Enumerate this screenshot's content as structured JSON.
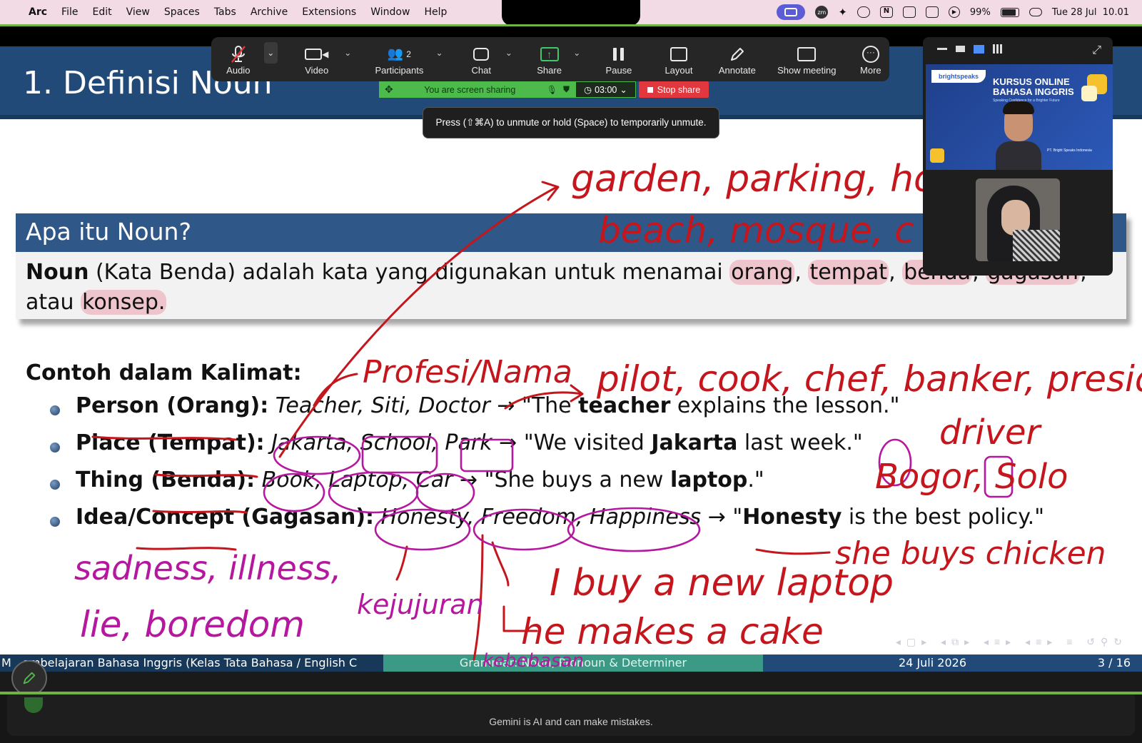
{
  "menubar": {
    "app": "Arc",
    "items": [
      "File",
      "Edit",
      "View",
      "Spaces",
      "Tabs",
      "Archive",
      "Extensions",
      "Window",
      "Help"
    ],
    "battery": "99%",
    "datetime": "Tue 28 Jul  10.01"
  },
  "slide": {
    "title": "1. Definisi Noun",
    "block_title": "Apa itu Noun?",
    "definition": {
      "term": "Noun",
      "rest": " (Kata Benda) adalah kata yang digunakan untuk menamai ",
      "w1": "orang",
      "w2": "tempat",
      "w3": "benda",
      "w4": "gagasan",
      "or": "atau",
      "w5": "konsep."
    },
    "examples_title": "Contoh dalam Kalimat:",
    "rows": [
      {
        "cat": "Person (Orang):",
        "ex": "Teacher, Siti, Doctor",
        "arrow": "→",
        "q1": "\"The ",
        "bold": "teacher",
        "q2": " explains the lesson.\""
      },
      {
        "cat": "Place (Tempat):",
        "ex": "Jakarta, School, Park",
        "arrow": "→",
        "q1": "\"We visited ",
        "bold": "Jakarta",
        "q2": " last week.\""
      },
      {
        "cat": "Thing (Benda):",
        "ex": "Book, Laptop, Car",
        "arrow": "→",
        "q1": "\"She buys a new ",
        "bold": "laptop",
        "q2": ".\""
      },
      {
        "cat": "Idea/Concept (Gagasan):",
        "ex": "Honesty, Freedom, Happiness",
        "arrow": "→",
        "q1": "\"",
        "bold": "Honesty",
        "q2": " is the best policy.\""
      }
    ],
    "footer": {
      "left": "M   embelajaran Bahasa Inggris (Kelas Tata Bahasa / English C",
      "middle": "Grammar: Noun, Pronoun & Determiner",
      "date": "24 Juli 2026",
      "page": "3 / 16"
    },
    "annotations": {
      "places": "garden, parking, house",
      "places2": "beach, mosque, c",
      "profesi": "Profesi/Nama",
      "professions": "pilot, cook, chef, banker, president",
      "driver": "driver",
      "cities": "Bogor, Solo",
      "abstract1": "sadness, illness,",
      "abstract2": "lie, boredom",
      "kejujuran": "kejujuran",
      "kebebasan": "kebebasan",
      "sentence1": "I buy a new laptop",
      "sentence2": "she buys chicken",
      "sentence3": "he makes a cake"
    }
  },
  "zoom": {
    "audio": "Audio",
    "video": "Video",
    "participants": "Participants",
    "participants_count": "2",
    "chat": "Chat",
    "share": "Share",
    "pause": "Pause",
    "layout": "Layout",
    "annotate": "Annotate",
    "show_meeting": "Show meeting",
    "more": "More",
    "sharing_status": "You are screen sharing",
    "timer": "03:00",
    "stop_share": "Stop share",
    "tooltip": "Press (⇧⌘A) to unmute or hold (Space) to temporarily unmute."
  },
  "panel": {
    "logo": "brightspeaks",
    "course_line1": "KURSUS ONLINE",
    "course_line2": "BAHASA INGGRIS",
    "tagline": "Speaking Confidence for a Brighter Future",
    "company": "PT. Bright Speaks Indonesia"
  },
  "gemini": {
    "disclaimer": "Gemini is AI and can make mistakes."
  },
  "colors": {
    "slide_header": "#214a78",
    "ink_red": "#c4161c",
    "ink_magenta": "#b5179e",
    "share_green": "#4cbb4c",
    "stop_red": "#e0383e"
  }
}
